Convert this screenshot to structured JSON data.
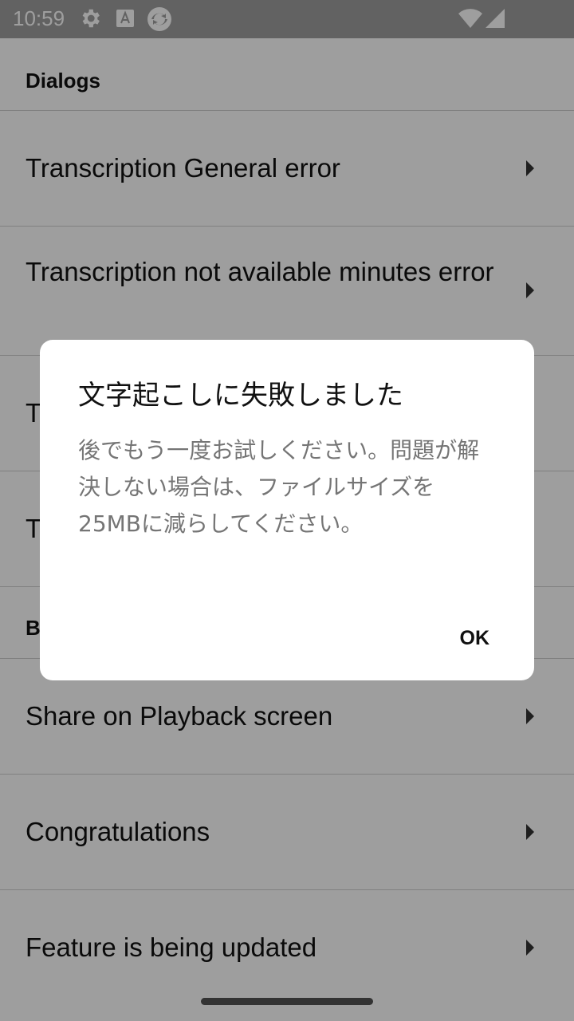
{
  "status_bar": {
    "time": "10:59",
    "icons": [
      "gear-icon",
      "a-icon",
      "sync-icon",
      "wifi-icon",
      "signal-icon"
    ]
  },
  "sections": [
    {
      "header": "Dialogs",
      "items": [
        {
          "label": "Transcription General error"
        },
        {
          "label": "Transcription not available minutes error"
        },
        {
          "label": "T"
        },
        {
          "label": "T"
        }
      ]
    },
    {
      "header": "B",
      "items": [
        {
          "label": "Share on Playback screen"
        },
        {
          "label": "Congratulations"
        },
        {
          "label": "Feature is being updated"
        }
      ]
    }
  ],
  "dialog": {
    "title": "文字起こしに失敗しました",
    "message": "後でもう一度お試しください。問題が解決しない場合は、ファイルサイズを25MBに減らしてください。",
    "ok_label": "OK"
  },
  "colors": {
    "background": "#ffffff",
    "scrim": "#000000",
    "text": "#111111",
    "secondary_text": "#757575"
  }
}
